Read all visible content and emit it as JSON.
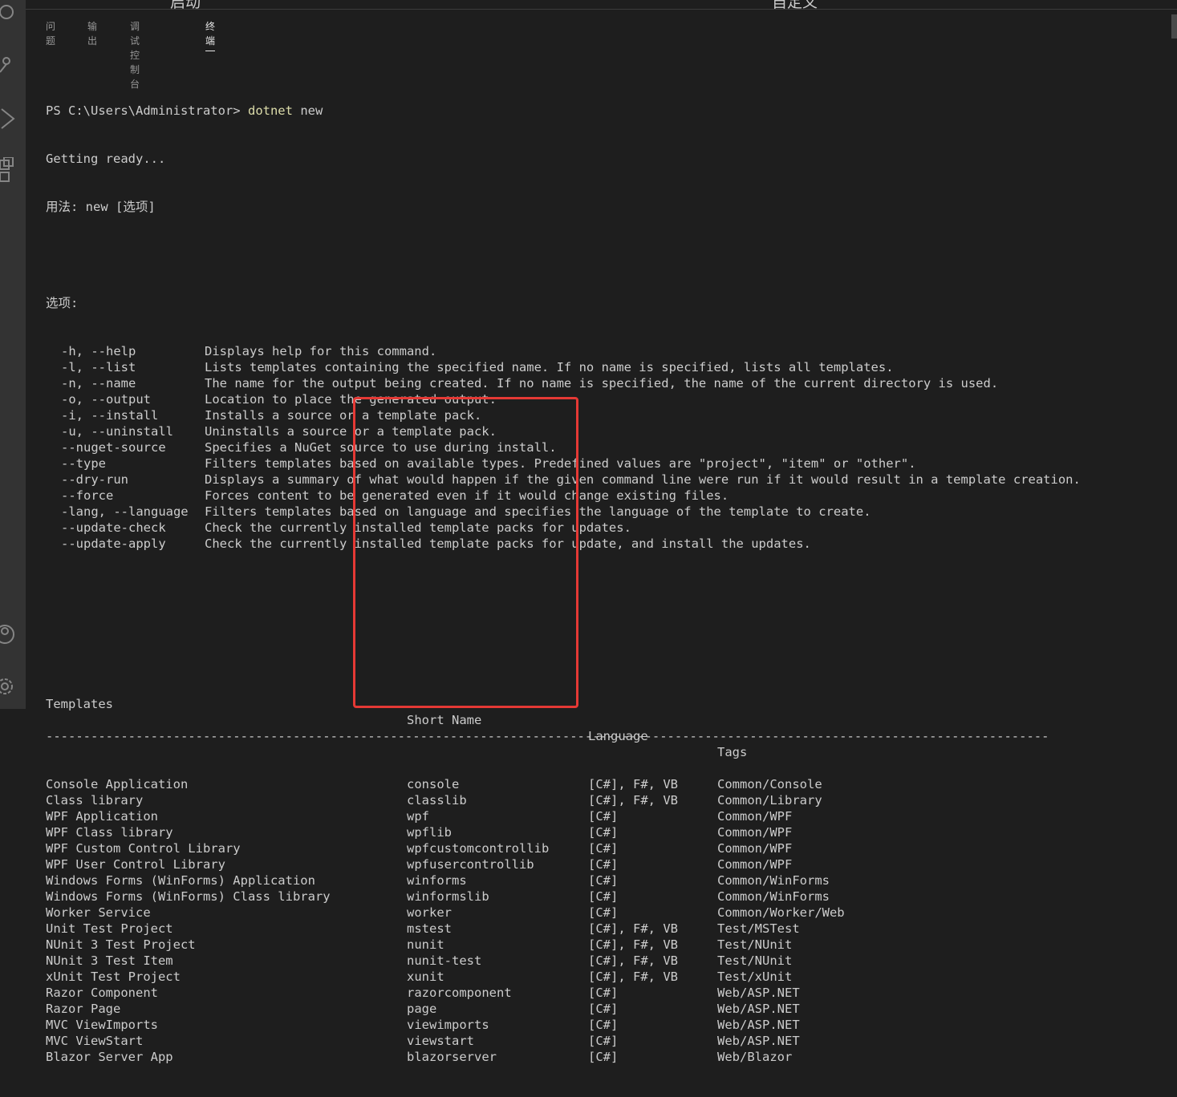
{
  "top_sliver": {
    "left": "启动",
    "right": "自定义"
  },
  "tabs": [
    {
      "label": "问题"
    },
    {
      "label": "输出"
    },
    {
      "label": "调试控制台"
    },
    {
      "label": "终端",
      "active": true
    }
  ],
  "terminal": {
    "prompt": "PS C:\\Users\\Administrator>",
    "command": "dotnet",
    "argument": "new",
    "getting_ready": "Getting ready...",
    "usage": "用法: new [选项]",
    "options_header": "选项:",
    "options": [
      {
        "flag": "-h, --help",
        "desc": "Displays help for this command."
      },
      {
        "flag": "-l, --list",
        "desc": "Lists templates containing the specified name. If no name is specified, lists all templates."
      },
      {
        "flag": "-n, --name",
        "desc": "The name for the output being created. If no name is specified, the name of the current directory is used."
      },
      {
        "flag": "-o, --output",
        "desc": "Location to place the generated output."
      },
      {
        "flag": "-i, --install",
        "desc": "Installs a source or a template pack."
      },
      {
        "flag": "-u, --uninstall",
        "desc": "Uninstalls a source or a template pack."
      },
      {
        "flag": "--nuget-source",
        "desc": "Specifies a NuGet source to use during install."
      },
      {
        "flag": "--type",
        "desc": "Filters templates based on available types. Predefined values are \"project\", \"item\" or \"other\"."
      },
      {
        "flag": "--dry-run",
        "desc": "Displays a summary of what would happen if the given command line were run if it would result in a template creation."
      },
      {
        "flag": "--force",
        "desc": "Forces content to be generated even if it would change existing files."
      },
      {
        "flag": "-lang, --language",
        "desc": "Filters templates based on language and specifies the language of the template to create."
      },
      {
        "flag": "--update-check",
        "desc": "Check the currently installed template packs for updates."
      },
      {
        "flag": "--update-apply",
        "desc": "Check the currently installed template packs for update, and install the updates."
      }
    ],
    "table_headers": {
      "templates": "Templates",
      "short_name": "Short Name",
      "language": "Language",
      "tags": "Tags"
    },
    "separator": "--------------------------------------------------------------------------------------------------------------------------------------",
    "templates": [
      {
        "name": "Console Application",
        "short": "console",
        "lang": "[C#], F#, VB",
        "tags": "Common/Console"
      },
      {
        "name": "Class library",
        "short": "classlib",
        "lang": "[C#], F#, VB",
        "tags": "Common/Library"
      },
      {
        "name": "WPF Application",
        "short": "wpf",
        "lang": "[C#]",
        "tags": "Common/WPF"
      },
      {
        "name": "WPF Class library",
        "short": "wpflib",
        "lang": "[C#]",
        "tags": "Common/WPF"
      },
      {
        "name": "WPF Custom Control Library",
        "short": "wpfcustomcontrollib",
        "lang": "[C#]",
        "tags": "Common/WPF"
      },
      {
        "name": "WPF User Control Library",
        "short": "wpfusercontrollib",
        "lang": "[C#]",
        "tags": "Common/WPF"
      },
      {
        "name": "Windows Forms (WinForms) Application",
        "short": "winforms",
        "lang": "[C#]",
        "tags": "Common/WinForms"
      },
      {
        "name": "Windows Forms (WinForms) Class library",
        "short": "winformslib",
        "lang": "[C#]",
        "tags": "Common/WinForms"
      },
      {
        "name": "Worker Service",
        "short": "worker",
        "lang": "[C#]",
        "tags": "Common/Worker/Web"
      },
      {
        "name": "Unit Test Project",
        "short": "mstest",
        "lang": "[C#], F#, VB",
        "tags": "Test/MSTest"
      },
      {
        "name": "NUnit 3 Test Project",
        "short": "nunit",
        "lang": "[C#], F#, VB",
        "tags": "Test/NUnit"
      },
      {
        "name": "NUnit 3 Test Item",
        "short": "nunit-test",
        "lang": "[C#], F#, VB",
        "tags": "Test/NUnit"
      },
      {
        "name": "xUnit Test Project",
        "short": "xunit",
        "lang": "[C#], F#, VB",
        "tags": "Test/xUnit"
      },
      {
        "name": "Razor Component",
        "short": "razorcomponent",
        "lang": "[C#]",
        "tags": "Web/ASP.NET"
      },
      {
        "name": "Razor Page",
        "short": "page",
        "lang": "[C#]",
        "tags": "Web/ASP.NET"
      },
      {
        "name": "MVC ViewImports",
        "short": "viewimports",
        "lang": "[C#]",
        "tags": "Web/ASP.NET"
      },
      {
        "name": "MVC ViewStart",
        "short": "viewstart",
        "lang": "[C#]",
        "tags": "Web/ASP.NET"
      },
      {
        "name": "Blazor Server App",
        "short": "blazorserver",
        "lang": "[C#]",
        "tags": "Web/Blazor"
      }
    ]
  },
  "colors": {
    "background": "#1e1e1e",
    "activity_bar": "#333333",
    "text": "#cccccc",
    "command": "#dcdcaa",
    "highlight_box": "#e53935"
  },
  "icons": {
    "activity": [
      "search-icon",
      "source-control-icon",
      "run-debug-icon",
      "extensions-icon",
      "account-icon",
      "gear-icon"
    ]
  }
}
